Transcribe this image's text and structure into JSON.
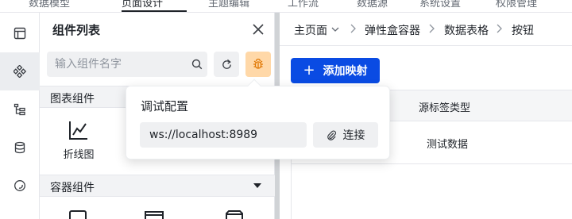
{
  "top_tabs": [
    "数据模型",
    "页面设计",
    "主题编辑",
    "工作流",
    "数据源",
    "系统设置",
    "权限管理"
  ],
  "panel": {
    "title": "组件列表",
    "search_placeholder": "输入组件名字",
    "categories": [
      {
        "label": "图表组件",
        "components": [
          {
            "name": "折线图",
            "icon": "line-chart-icon"
          }
        ]
      },
      {
        "label": "容器组件",
        "components": []
      }
    ]
  },
  "breadcrumb": [
    "主页面",
    "弹性盒容器",
    "数据表格",
    "按钮"
  ],
  "main": {
    "add_button_label": "添加映射",
    "table": {
      "header": "源标签类型",
      "rows": [
        "测试数据"
      ]
    }
  },
  "debug_popover": {
    "title": "调试配置",
    "url_value": "ws://localhost:8989",
    "connect_label": "连接"
  },
  "colors": {
    "primary": "#0a4be3",
    "debug_button": "#ffd8a8"
  }
}
